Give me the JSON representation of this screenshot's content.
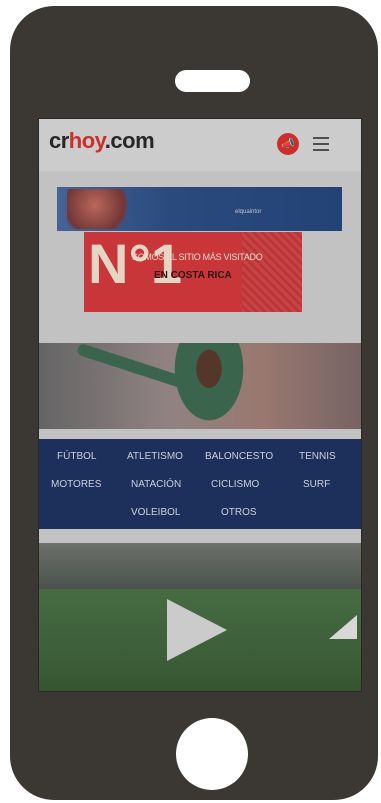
{
  "header": {
    "logo_part1": "cr",
    "logo_part2": "hoy",
    "logo_part3": ".com",
    "megaphone_icon": "megaphone-icon",
    "menu_icon": "hamburger-menu-icon"
  },
  "ad_banner_top": {
    "sponsor_text": "elquaintor"
  },
  "ad_banner_main": {
    "number": "N°1",
    "line1": "SOMOS EL SITIO MÁS VISITADO",
    "line2": "EN COSTA RICA"
  },
  "sports_nav": {
    "items": [
      "FÚTBOL",
      "ATLETISMO",
      "BALONCESTO",
      "TENNIS",
      "MOTORES",
      "NATACIÓN",
      "CICLISMO",
      "SURF",
      "VOLEIBOL",
      "OTROS"
    ]
  },
  "video": {
    "play_icon": "play-icon"
  },
  "colors": {
    "brand_red": "#d8322e",
    "nav_blue": "#1f3462",
    "phone_body": "#3b3834"
  }
}
